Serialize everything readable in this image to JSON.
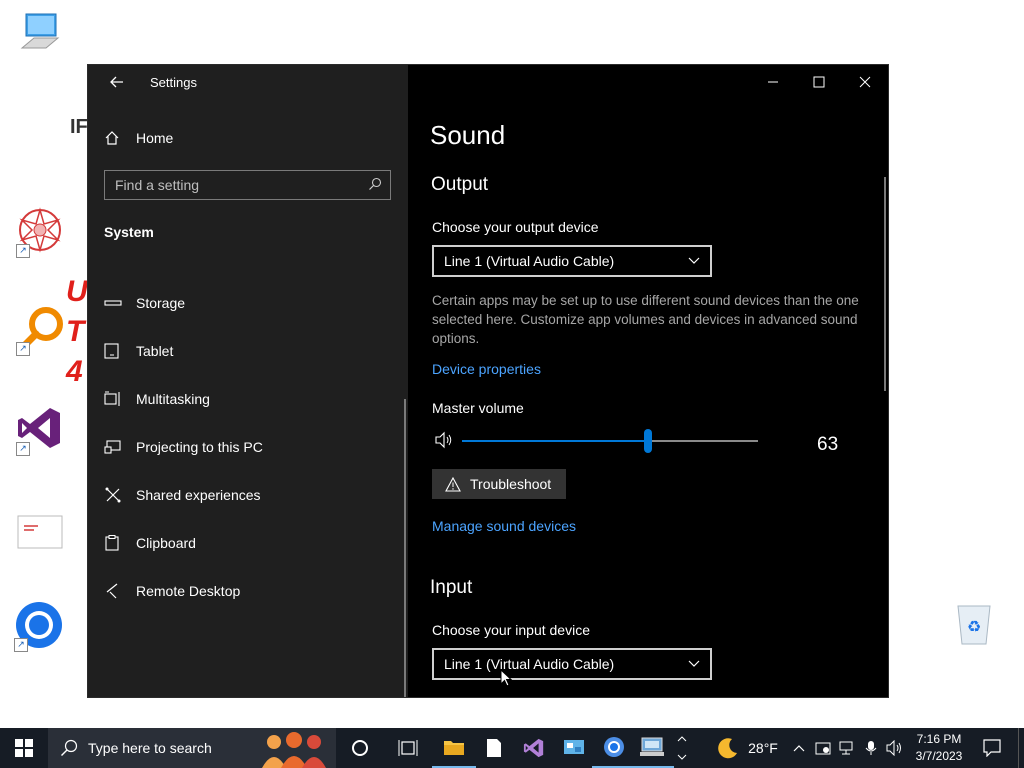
{
  "window": {
    "title": "Settings",
    "home_label": "Home",
    "search": {
      "placeholder": "Find a setting"
    },
    "section_label": "System",
    "nav_items": [
      {
        "label": "Storage",
        "icon": "storage-icon"
      },
      {
        "label": "Tablet",
        "icon": "tablet-icon"
      },
      {
        "label": "Multitasking",
        "icon": "multitasking-icon"
      },
      {
        "label": "Projecting to this PC",
        "icon": "projecting-icon"
      },
      {
        "label": "Shared experiences",
        "icon": "shared-experiences-icon"
      },
      {
        "label": "Clipboard",
        "icon": "clipboard-icon"
      },
      {
        "label": "Remote Desktop",
        "icon": "remote-desktop-icon"
      }
    ]
  },
  "sound": {
    "title": "Sound",
    "output": {
      "heading": "Output",
      "choose_label": "Choose your output device",
      "device": "Line 1 (Virtual Audio Cable)",
      "description": "Certain apps may be set up to use different sound devices than the one selected here. Customize app volumes and devices in advanced sound options.",
      "device_properties_link": "Device properties",
      "master_volume_label": "Master volume",
      "volume_value": "63",
      "volume_fraction": 0.63,
      "troubleshoot_label": "Troubleshoot",
      "manage_link": "Manage sound devices"
    },
    "input": {
      "heading": "Input",
      "choose_label": "Choose your input device",
      "device": "Line 1 (Virtual Audio Cable)"
    }
  },
  "taskbar": {
    "search_placeholder": "Type here to search",
    "weather_temp": "28°F",
    "time": "7:16 PM",
    "date": "3/7/2023"
  },
  "desktop": {
    "partial_text_1": "IF",
    "partial_text_2": "U",
    "partial_text_3": "T",
    "partial_text_4": "4"
  },
  "colors": {
    "accent": "#0078d7",
    "link": "#4ca4ff",
    "sidebar_bg": "#1f1f1f",
    "content_bg": "#000000",
    "taskbar_bg": "#161c25"
  }
}
